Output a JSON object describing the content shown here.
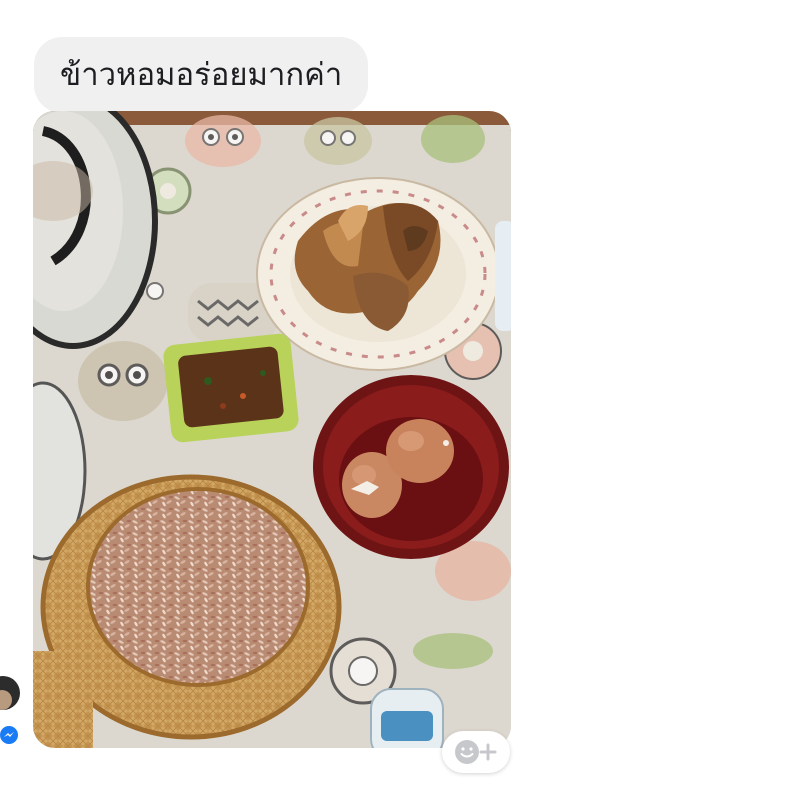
{
  "conversation": {
    "message_text": "ข้าวหอมอร่อยมากค่า",
    "photo_alt": "Photo",
    "avatar_label": "Sender avatar",
    "app_badge": "messenger-icon",
    "reaction_button_icon": "smiley-plus-icon"
  },
  "colors": {
    "bubble_bg": "#f0f0f0",
    "messenger_blue": "#1a7cf5",
    "text": "#1c1e21"
  }
}
